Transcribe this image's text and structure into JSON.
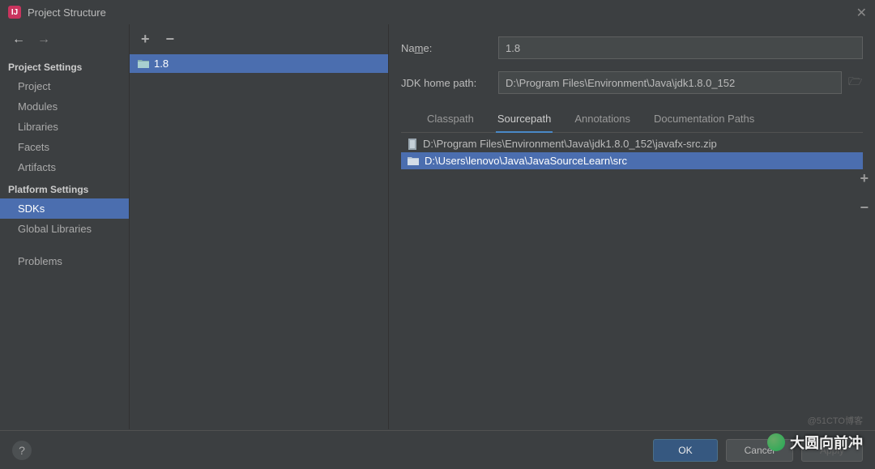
{
  "window": {
    "title": "Project Structure"
  },
  "sidebar": {
    "sections": [
      {
        "header": "Project Settings",
        "items": [
          "Project",
          "Modules",
          "Libraries",
          "Facets",
          "Artifacts"
        ]
      },
      {
        "header": "Platform Settings",
        "items": [
          "SDKs",
          "Global Libraries"
        ]
      },
      {
        "header": "",
        "items": [
          "Problems"
        ]
      }
    ],
    "selected": "SDKs"
  },
  "sdk_list": {
    "items": [
      "1.8"
    ],
    "selected": "1.8"
  },
  "detail": {
    "name_label": "Name:",
    "name_value": "1.8",
    "home_label": "JDK home path:",
    "home_value": "D:\\Program Files\\Environment\\Java\\jdk1.8.0_152",
    "tabs": [
      "Classpath",
      "Sourcepath",
      "Annotations",
      "Documentation Paths"
    ],
    "active_tab": "Sourcepath",
    "paths": [
      {
        "text": "D:\\Program Files\\Environment\\Java\\jdk1.8.0_152\\javafx-src.zip",
        "selected": false,
        "kind": "archive"
      },
      {
        "text": "D:\\Users\\lenovo\\Java\\JavaSourceLearn\\src",
        "selected": true,
        "kind": "folder"
      }
    ]
  },
  "buttons": {
    "ok": "OK",
    "cancel": "Cancel",
    "apply": "Apply"
  },
  "overlay": {
    "speech": "大圆向前冲",
    "watermark": "@51CTO博客"
  }
}
